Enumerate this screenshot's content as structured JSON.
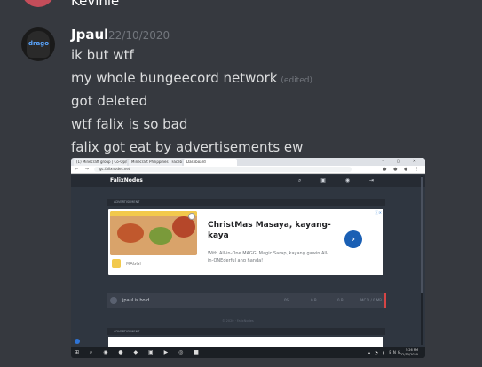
{
  "previous_message": {
    "author": "Kevinle"
  },
  "message": {
    "author": "Jpaul",
    "timestamp": "22/10/2020",
    "lines": [
      {
        "text": "ik but wtf"
      },
      {
        "text": "my whole bungeecord network",
        "edited": "(edited)"
      },
      {
        "text": "got deleted"
      },
      {
        "text": "wtf falix is so bad"
      },
      {
        "text": "falix got eat by advertisements ew"
      }
    ]
  },
  "screenshot": {
    "tabs": [
      "(1) Minecraft group | Co-Op/PvP (s",
      "Minecraft Philippines | Facebook",
      "Dashboard"
    ],
    "url": "gc.falixnodes.net",
    "brand": "FalixNodes",
    "ad_label": "ADVERTISEMENT",
    "ad": {
      "title": "ChristMas Masaya, kayang-kaya",
      "description": "With All-in-One MAGGI Magic Sarap, kayang gawin All-in-ONEderful ang handa!",
      "brand": "MAGGI",
      "arrow": "›"
    },
    "server": {
      "name": "jpaul is bold",
      "stats": [
        "0%",
        "0 B",
        "0 B",
        "MC 0 / 0 MB"
      ]
    },
    "footer": "© 2020 · FalixNodes",
    "taskbar_clock": {
      "time": "5:26 PM",
      "date": "22/10/2020"
    },
    "taskbar_lang": "ENG"
  }
}
